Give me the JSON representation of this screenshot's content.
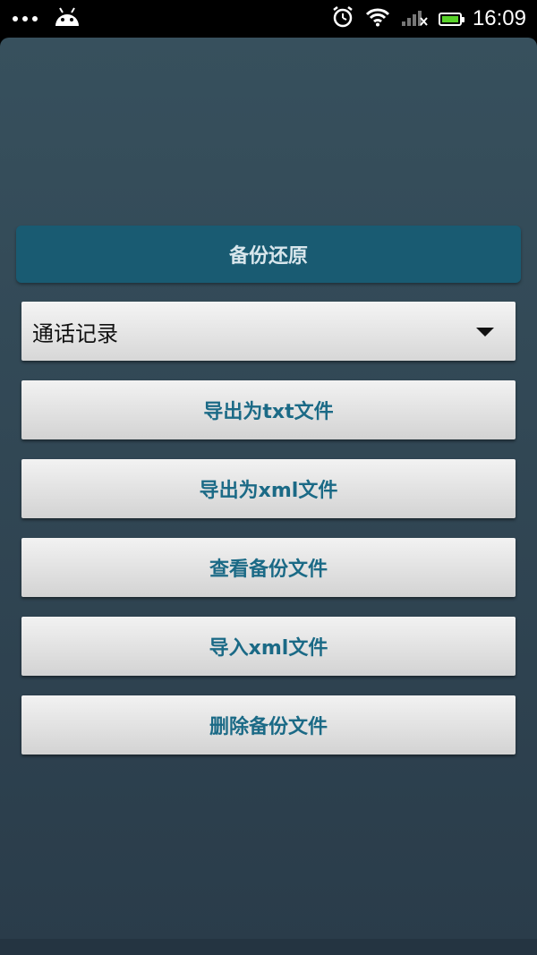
{
  "status_bar": {
    "time": "16:09",
    "icons": [
      "more-dots-icon",
      "android-icon",
      "alarm-icon",
      "wifi-icon",
      "signal-icon",
      "battery-icon"
    ],
    "battery_color": "#59d22a"
  },
  "header": {
    "title": "备份还原"
  },
  "spinner": {
    "selected": "通话记录"
  },
  "buttons": [
    {
      "label": "导出为txt文件"
    },
    {
      "label": "导出为xml文件"
    },
    {
      "label": "查看备份文件"
    },
    {
      "label": "导入xml文件"
    },
    {
      "label": "删除备份文件"
    }
  ],
  "colors": {
    "header_bg": "#195b72",
    "button_text": "#1b6a86",
    "background_top": "#37505d",
    "background_bottom": "#2a3c4a"
  }
}
